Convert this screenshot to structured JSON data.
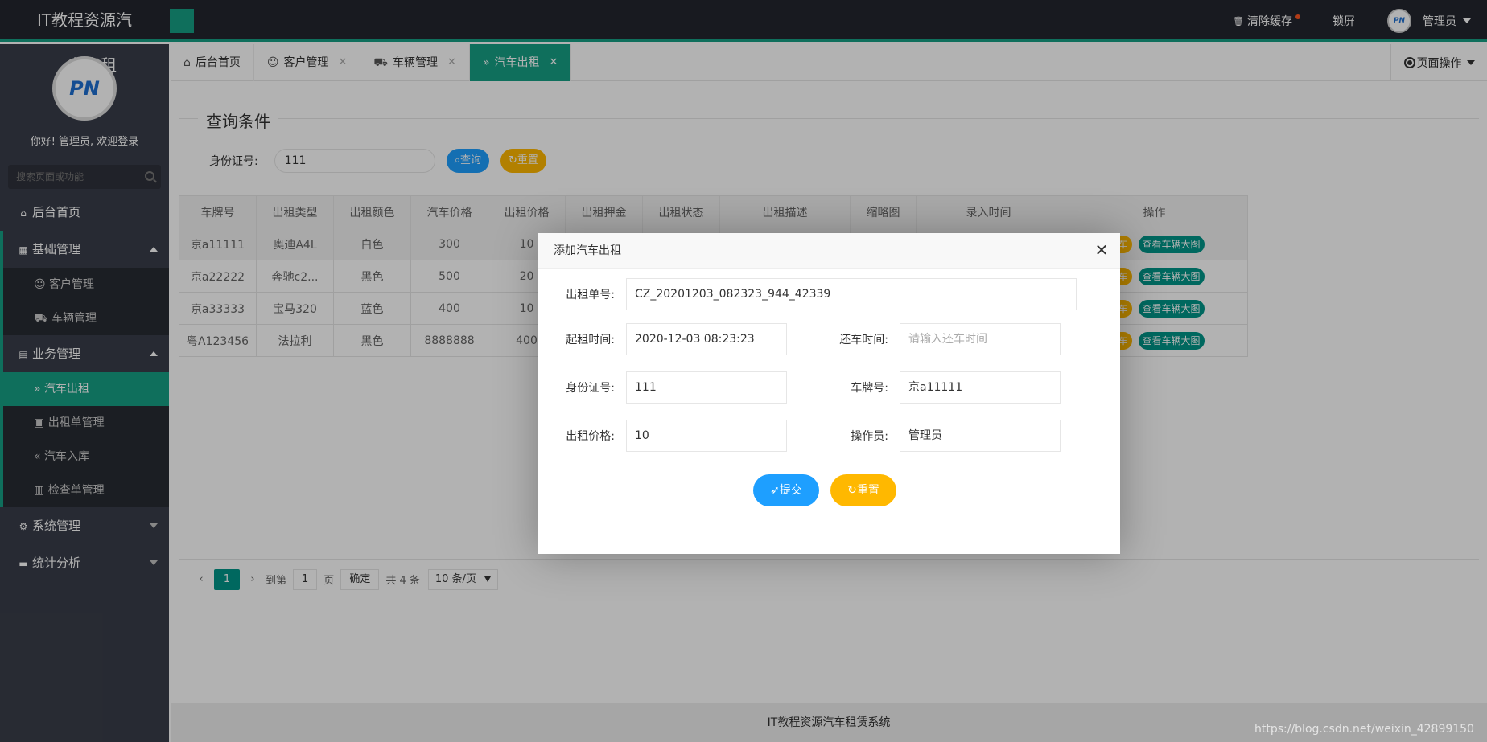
{
  "header": {
    "logo": "IT教程资源汽",
    "clear_cache": "清除缓存",
    "lock": "锁屏",
    "admin": "管理员",
    "avatar_text": "PN"
  },
  "sidebar": {
    "title": "车出租",
    "avatar_text": "PN",
    "welcome": "你好! 管理员, 欢迎登录",
    "search_placeholder": "搜索页面或功能",
    "home": "后台首页",
    "basic": "基础管理",
    "basic_items": [
      "客户管理",
      "车辆管理"
    ],
    "business": "业务管理",
    "business_items": [
      "汽车出租",
      "出租单管理",
      "汽车入库",
      "检查单管理"
    ],
    "system": "系统管理",
    "stats": "统计分析"
  },
  "tabs": [
    {
      "label": "后台首页",
      "icon": "home-icon"
    },
    {
      "label": "客户管理",
      "icon": "user-icon"
    },
    {
      "label": "车辆管理",
      "icon": "cart-icon"
    },
    {
      "label": "汽车出租",
      "icon": "double-right-icon"
    }
  ],
  "page_ops": "页面操作",
  "query": {
    "legend": "查询条件",
    "id_label": "身份证号:",
    "id_value": "111",
    "search_btn": "查询",
    "reset_btn": "重置"
  },
  "table": {
    "headers": [
      "车牌号",
      "出租类型",
      "出租颜色",
      "汽车价格",
      "出租价格",
      "出租押金",
      "出租状态",
      "出租描述",
      "缩略图",
      "录入时间",
      "操作"
    ],
    "rows": [
      {
        "plate": "京a11111",
        "type": "奥迪A4L",
        "color": "白色",
        "price": "300",
        "rent": "10"
      },
      {
        "plate": "京a22222",
        "type": "奔驰c2...",
        "color": "黑色",
        "price": "500",
        "rent": "20"
      },
      {
        "plate": "京a33333",
        "type": "宝马320",
        "color": "蓝色",
        "price": "400",
        "rent": "10"
      },
      {
        "plate": "粤A123456",
        "type": "法拉利",
        "color": "黑色",
        "price": "8888888",
        "rent": "400"
      }
    ],
    "op_yellow": "汽车",
    "op_green": "查看车辆大图"
  },
  "pager": {
    "current": "1",
    "goto": "到第",
    "page_input": "1",
    "page_unit": "页",
    "confirm": "确定",
    "total": "共 4 条",
    "per_page": "10 条/页"
  },
  "footer": "IT教程资源汽车租赁系统",
  "watermark": "https://blog.csdn.net/weixin_42899150",
  "modal": {
    "title": "添加汽车出租",
    "order_label": "出租单号:",
    "order_value": "CZ_20201203_082323_944_42339",
    "start_label": "起租时间:",
    "start_value": "2020-12-03 08:23:23",
    "return_label": "还车时间:",
    "return_placeholder": "请输入还车时间",
    "id_label": "身份证号:",
    "id_value": "111",
    "plate_label": "车牌号:",
    "plate_value": "京a11111",
    "price_label": "出租价格:",
    "price_value": "10",
    "operator_label": "操作员:",
    "operator_value": "管理员",
    "submit": "提交",
    "reset": "重置"
  }
}
